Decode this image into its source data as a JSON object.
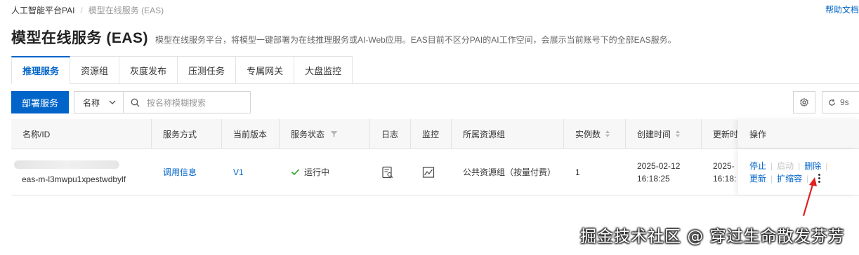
{
  "breadcrumb": {
    "root": "人工智能平台PAI",
    "separator": "/",
    "current": "模型在线服务 (EAS)"
  },
  "help_link": "帮助文档",
  "header": {
    "title": "模型在线服务 (EAS)",
    "description": "模型在线服务平台，将模型一键部署为在线推理服务或AI-Web应用。EAS目前不区分PAI的AI工作空间，会展示当前账号下的全部EAS服务。"
  },
  "tabs": [
    {
      "label": "推理服务",
      "active": true
    },
    {
      "label": "资源组",
      "active": false
    },
    {
      "label": "灰度发布",
      "active": false
    },
    {
      "label": "压测任务",
      "active": false
    },
    {
      "label": "专属网关",
      "active": false
    },
    {
      "label": "大盘监控",
      "active": false
    }
  ],
  "toolbar": {
    "deploy_label": "部署服务",
    "filter_field": "名称",
    "search_placeholder": "按名称模糊搜索",
    "refresh_label": "9s"
  },
  "table": {
    "headers": {
      "name": "名称/ID",
      "method": "服务方式",
      "version": "当前版本",
      "status": "服务状态",
      "log": "日志",
      "monitor": "监控",
      "resource_group": "所属资源组",
      "instances": "实例数",
      "created": "创建时间",
      "updated": "更新时",
      "actions": "操作"
    },
    "row": {
      "id": "eas-m-l3mwpu1xpestwdbylf",
      "method": "调用信息",
      "version": "V1",
      "status": "运行中",
      "resource_group": "公共资源组（按量付费）",
      "instances": "1",
      "created_date": "2025-02-12",
      "created_time": "16:18:25",
      "updated_date": "2025-",
      "updated_time": "16:18:",
      "actions": {
        "stop": "停止",
        "start": "启动",
        "delete": "删除",
        "update": "更新",
        "scale": "扩缩容"
      }
    }
  },
  "watermark": "掘金技术社区 @ 穿过生命散发芬芳",
  "colors": {
    "primary": "#0064c8",
    "success": "#2ea121",
    "annotation": "#e02020"
  }
}
